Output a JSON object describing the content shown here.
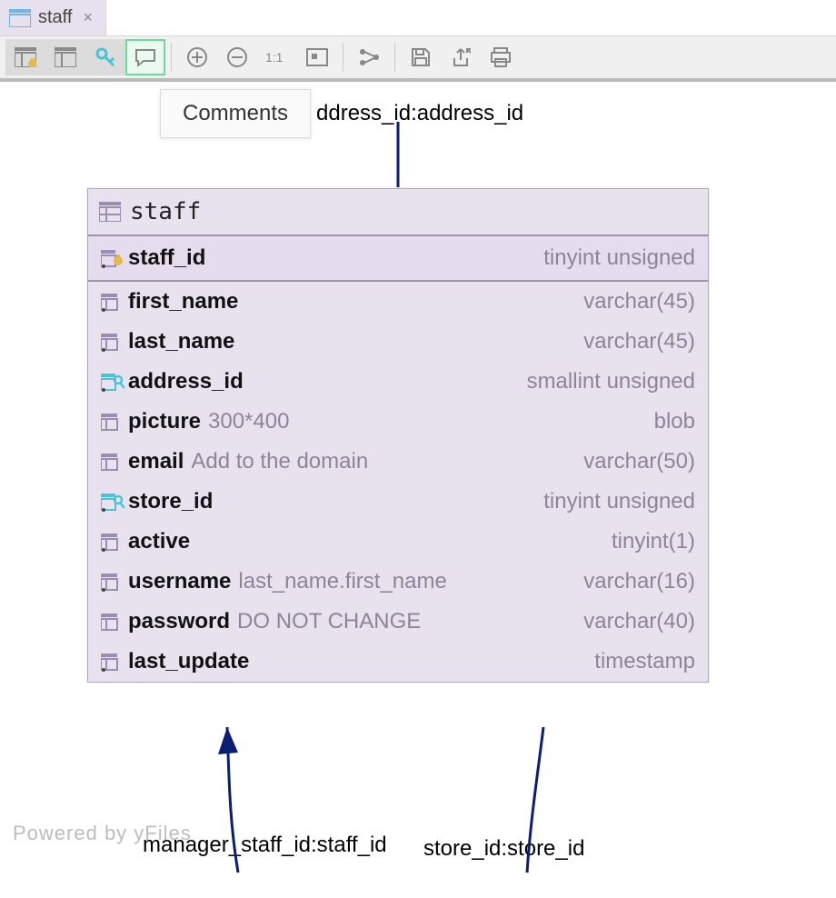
{
  "tab": {
    "label": "staff",
    "close_glyph": "×"
  },
  "tooltip": "Comments",
  "entity": {
    "title": "staff",
    "pk": {
      "name": "staff_id",
      "type": "tinyint unsigned"
    },
    "columns": [
      {
        "icon": "col",
        "name": "first_name",
        "comment": "",
        "type": "varchar(45)"
      },
      {
        "icon": "col",
        "name": "last_name",
        "comment": "",
        "type": "varchar(45)"
      },
      {
        "icon": "fk",
        "name": "address_id",
        "comment": "",
        "type": "smallint unsigned"
      },
      {
        "icon": "colnp",
        "name": "picture",
        "comment": "300*400",
        "type": "blob"
      },
      {
        "icon": "colnp",
        "name": "email",
        "comment": "Add to the domain",
        "type": "varchar(50)"
      },
      {
        "icon": "fk",
        "name": "store_id",
        "comment": "",
        "type": "tinyint unsigned"
      },
      {
        "icon": "col",
        "name": "active",
        "comment": "",
        "type": "tinyint(1)"
      },
      {
        "icon": "col",
        "name": "username",
        "comment": "last_name.first_name",
        "type": "varchar(16)"
      },
      {
        "icon": "colnp",
        "name": "password",
        "comment": "DO NOT CHANGE",
        "type": "varchar(40)"
      },
      {
        "icon": "col",
        "name": "last_update",
        "comment": "",
        "type": "timestamp"
      }
    ]
  },
  "relations": {
    "top": "ddress_id:address_id",
    "bottom_left": "manager_staff_id:staff_id",
    "bottom_right": "store_id:store_id"
  },
  "watermark": "Powered by yFiles"
}
